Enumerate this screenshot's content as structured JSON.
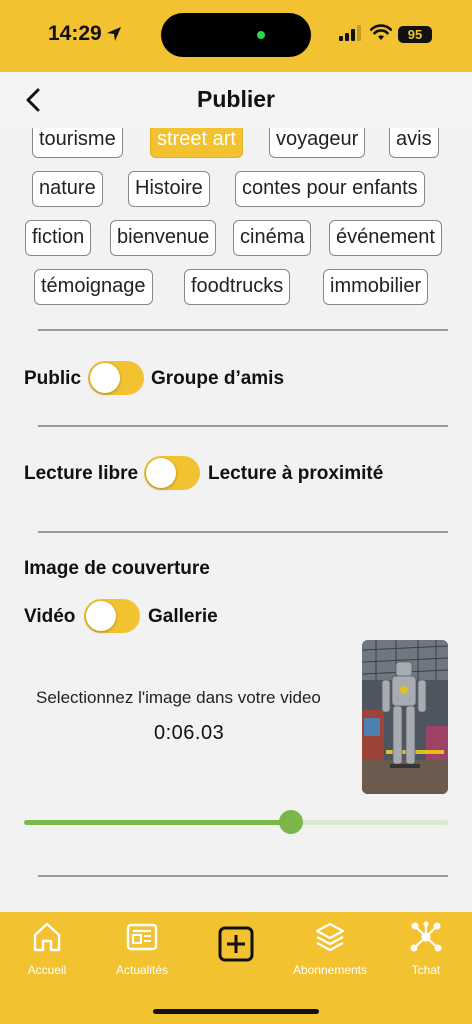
{
  "status_bar": {
    "time": "14:29",
    "battery": "95"
  },
  "header": {
    "title": "Publier"
  },
  "tags": [
    "tourisme",
    "street art",
    "voyageur",
    "avis",
    "nature",
    "Histoire",
    "contes pour enfants",
    "fiction",
    "bienvenue",
    "cinéma",
    "événement",
    "témoignage",
    "foodtrucks",
    "immobilier"
  ],
  "selected_tag": "street art",
  "privacy": {
    "left": "Public",
    "right": "Groupe d’amis"
  },
  "reading": {
    "left": "Lecture libre",
    "right": "Lecture à proximité"
  },
  "cover": {
    "title": "Image de couverture",
    "left": "Vidéo",
    "right": "Gallerie",
    "hint": "Selectionnez l'image dans votre video",
    "timecode": "0:06.03",
    "slider_fraction": 0.63
  },
  "nav": {
    "items": [
      {
        "label": "Accueil",
        "icon": "home-icon"
      },
      {
        "label": "Actualités",
        "icon": "news-icon"
      },
      {
        "label": "",
        "icon": "add-icon"
      },
      {
        "label": "Abonnements",
        "icon": "layers-icon"
      },
      {
        "label": "Tchat",
        "icon": "network-icon"
      }
    ]
  },
  "colors": {
    "accent": "#f2c230",
    "slider": "#7ab648"
  }
}
